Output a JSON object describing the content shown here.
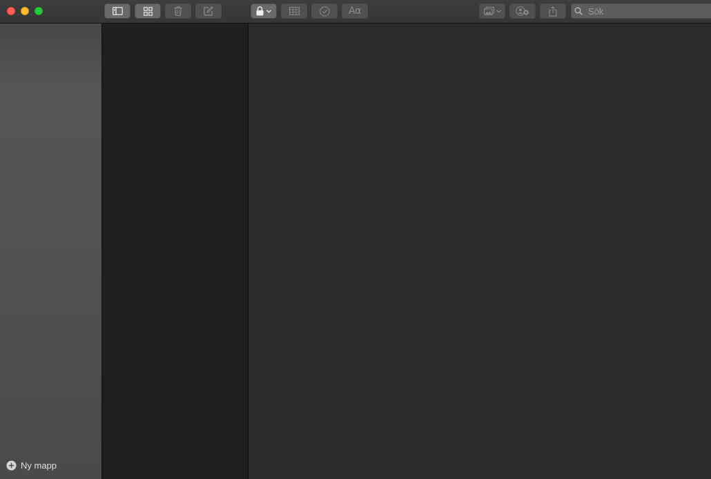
{
  "window": {
    "controls": {
      "close": "close-window",
      "minimize": "minimize-window",
      "zoom": "zoom-window"
    }
  },
  "toolbar": {
    "buttons": [
      {
        "id": "sidebar-toggle",
        "icon": "sidebar-icon",
        "active": true
      },
      {
        "id": "gallery-view",
        "icon": "grid-icon",
        "active": true
      },
      {
        "id": "delete",
        "icon": "trash-icon",
        "active": false
      },
      {
        "id": "new-note",
        "icon": "compose-icon",
        "active": false
      },
      {
        "id": "lock",
        "icon": "lock-icon",
        "active": true
      },
      {
        "id": "table",
        "icon": "table-icon",
        "active": false
      },
      {
        "id": "checklist",
        "icon": "checkmark-circle-icon",
        "active": false
      },
      {
        "id": "format",
        "icon": "text-format-icon",
        "active": false
      },
      {
        "id": "media",
        "icon": "photo-icon",
        "active": false
      },
      {
        "id": "collaborate",
        "icon": "add-people-icon",
        "active": false
      },
      {
        "id": "share",
        "icon": "share-icon",
        "active": false
      }
    ],
    "format_label": "Aα"
  },
  "search": {
    "placeholder": "Sök",
    "value": ""
  },
  "sidebar": {
    "new_folder_label": "Ny mapp"
  },
  "colors": {
    "close": "#fe5f57",
    "minimize": "#febc2e",
    "zoom": "#28c840",
    "toolbar": "#383838",
    "sidebar": "#505050",
    "note_list": "#1f1f1f",
    "editor": "#2a2a2a"
  }
}
